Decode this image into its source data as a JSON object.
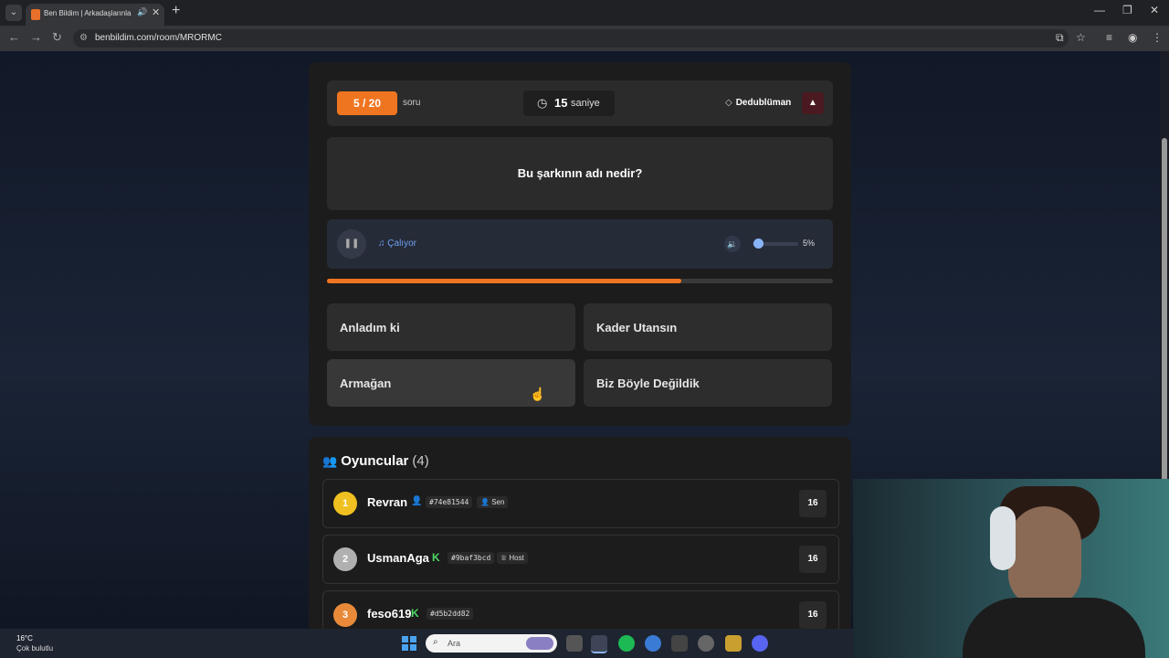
{
  "browser": {
    "tab_title": "Ben Bildim | Arkadaşlarınla",
    "tab_audio_icon": "speaker-icon",
    "url": "benbildim.com/room/MRORMC"
  },
  "quiz": {
    "counter": "5 / 20",
    "counter_suffix": "soru",
    "timer_value": "15",
    "timer_unit": "saniye",
    "category": "Dedublüman",
    "question": "Bu şarkının adı nedir?",
    "audio_status": "Çalıyor",
    "volume_label": "5%",
    "volume_level": 0.05,
    "progress": 0.7,
    "answers": [
      "Anladım ki",
      "Kader Utansın",
      "Armağan",
      "Biz Böyle Değildik"
    ]
  },
  "players": {
    "title": "Oyuncular",
    "count": "(4)",
    "list": [
      {
        "rank": "1",
        "name": "Revran",
        "id": "#74e81544",
        "role": "Sen",
        "score": "16",
        "color": "#f0c020"
      },
      {
        "rank": "2",
        "name": "UsmanAga",
        "id": "#9baf3bcd",
        "role": "Host",
        "score": "16",
        "color": "#b0b0b0"
      },
      {
        "rank": "3",
        "name": "feso619",
        "id": "#d5b2dd82",
        "role": "",
        "score": "16",
        "color": "#e88a3a"
      }
    ]
  },
  "taskbar": {
    "temperature": "16°C",
    "weather": "Çok bulutlu",
    "search_placeholder": "Ara"
  },
  "colors": {
    "accent": "#f07520",
    "link_blue": "#6aa0f0"
  }
}
